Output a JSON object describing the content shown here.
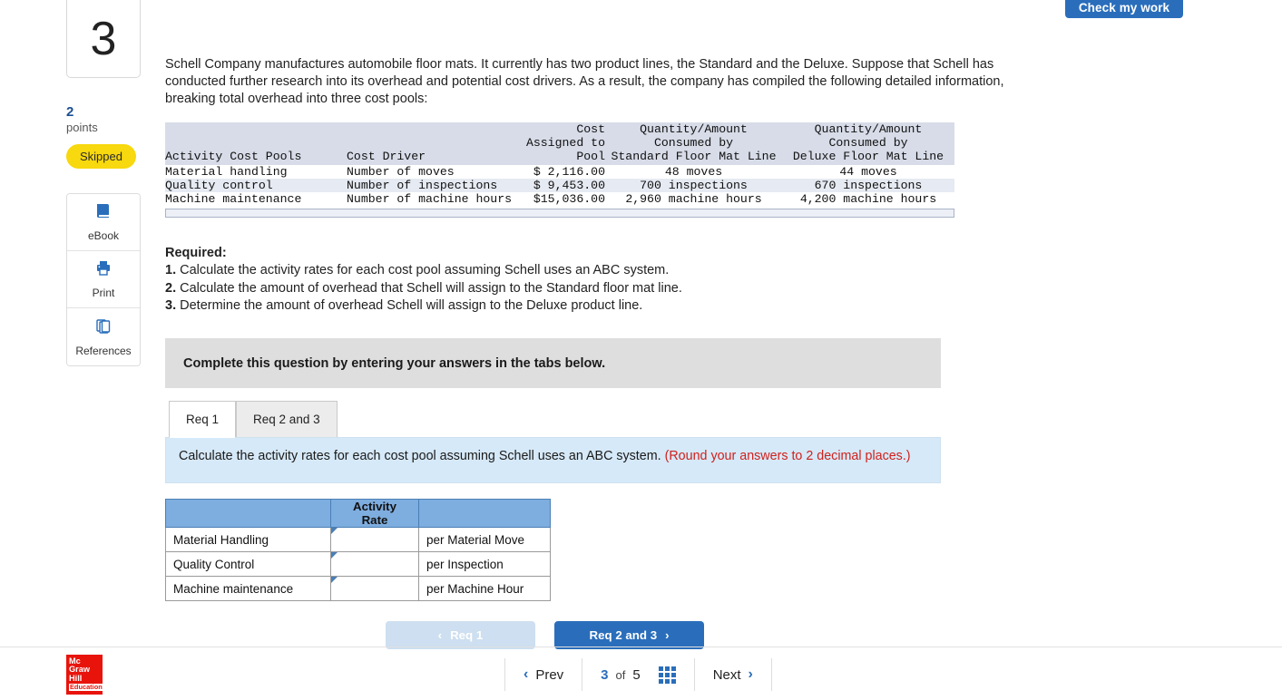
{
  "header": {
    "check_work_label": "Check my work"
  },
  "rail": {
    "question_number": "3",
    "points_value": "2",
    "points_label": "points",
    "status_badge": "Skipped",
    "tools": [
      {
        "label": "eBook",
        "icon": "book-icon"
      },
      {
        "label": "Print",
        "icon": "printer-icon"
      },
      {
        "label": "References",
        "icon": "copies-icon"
      }
    ]
  },
  "question": {
    "body": "Schell Company manufactures automobile floor mats. It currently has two product lines, the Standard and the Deluxe. Suppose that Schell has conducted further research into its overhead and potential cost drivers. As a result, the company has compiled the following detailed information, breaking total overhead into three cost pools:"
  },
  "data_table": {
    "header_line1": [
      "",
      "",
      "Cost",
      "Quantity/Amount",
      "Quantity/Amount"
    ],
    "header_line2": [
      "",
      "",
      "Assigned to",
      "Consumed by",
      "Consumed by"
    ],
    "header_line3": [
      "Activity Cost Pools",
      "Cost Driver",
      "Pool",
      "Standard Floor Mat Line",
      "Deluxe Floor Mat Line"
    ],
    "rows": [
      [
        "Material handling",
        "Number of moves",
        "$ 2,116.00",
        "48 moves",
        "44 moves"
      ],
      [
        "Quality control",
        "Number of inspections",
        "$ 9,453.00",
        "700 inspections",
        "670 inspections"
      ],
      [
        "Machine maintenance",
        "Number of machine hours",
        "$15,036.00",
        "2,960 machine hours",
        "4,200 machine hours"
      ]
    ]
  },
  "required": {
    "title": "Required:",
    "items": [
      {
        "num": "1.",
        "text": "Calculate the activity rates for each cost pool assuming Schell uses an ABC system."
      },
      {
        "num": "2.",
        "text": "Calculate the amount of overhead that Schell will assign to the Standard floor mat line."
      },
      {
        "num": "3.",
        "text": "Determine the amount of overhead Schell will assign to the Deluxe product line."
      }
    ]
  },
  "complete_banner": {
    "text": "Complete this question by entering your answers in the tabs below."
  },
  "tabs": [
    {
      "label": "Req 1",
      "active": true
    },
    {
      "label": "Req 2 and 3",
      "active": false
    }
  ],
  "prompt": {
    "text": "Calculate the activity rates for each cost pool assuming Schell uses an ABC system. ",
    "note": "(Round your answers to 2 decimal places.)"
  },
  "answer_table": {
    "col_blank_left": "",
    "col_rate": "Activity Rate",
    "col_blank_right": "",
    "rows": [
      {
        "label": "Material Handling",
        "value": "",
        "suffix": "per Material Move"
      },
      {
        "label": "Quality Control",
        "value": "",
        "suffix": "per Inspection"
      },
      {
        "label": "Machine maintenance",
        "value": "",
        "suffix": "per Machine Hour"
      }
    ]
  },
  "req_nav": {
    "prev_label": "Req 1",
    "prev_chevron": "‹",
    "next_label": "Req 2 and 3",
    "next_chevron": "›"
  },
  "footer": {
    "logo_line1": "Mc",
    "logo_line2": "Graw",
    "logo_line3": "Hill",
    "logo_line4": "Education",
    "prev_label": "Prev",
    "prev_chevron": "‹",
    "current_page": "3",
    "of_label": "of",
    "total_pages": "5",
    "next_label": "Next",
    "next_chevron": "›"
  },
  "colors": {
    "brand_blue": "#2a6ebb",
    "badge_yellow": "#f8d80e",
    "logo_red": "#e8140c",
    "table_header_blue": "#7eaddf",
    "prompt_blue": "#d6e9f8",
    "note_red": "#d0211c"
  }
}
